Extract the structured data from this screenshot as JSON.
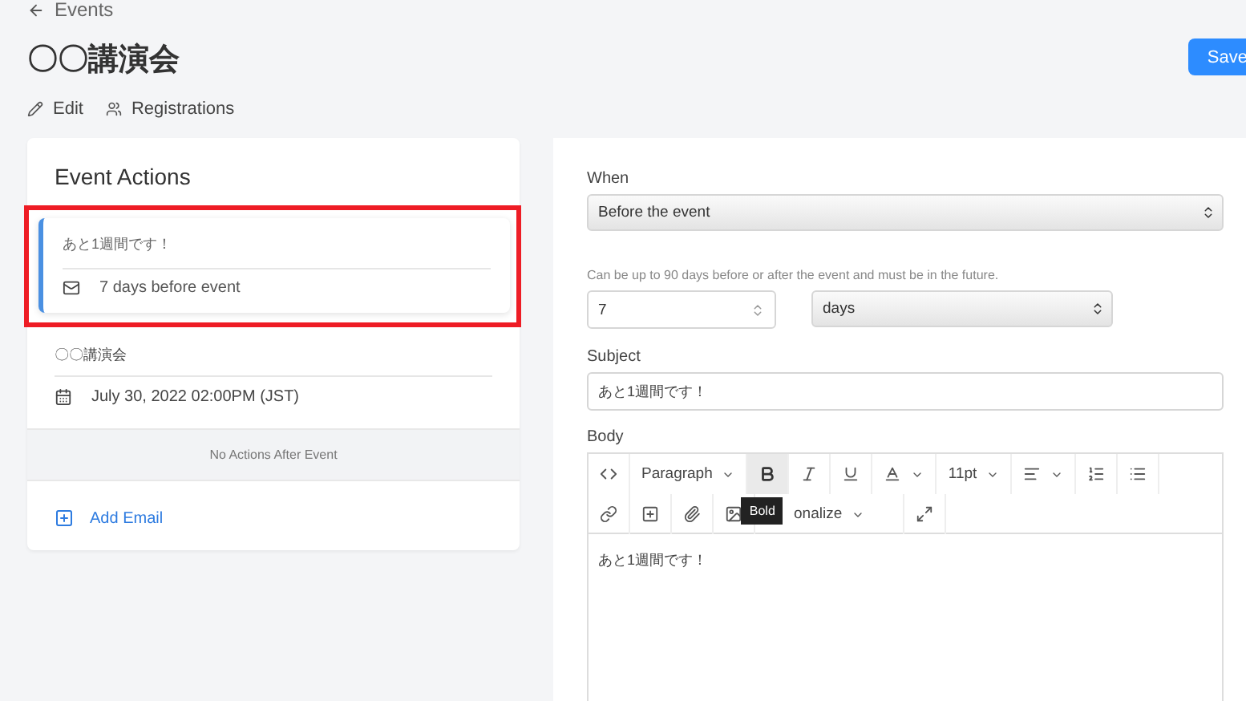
{
  "back_link": {
    "label": "Events"
  },
  "page_title": "〇〇講演会",
  "save_button": {
    "label": "Save"
  },
  "page_actions": [
    {
      "kind": "edit",
      "label": "Edit"
    },
    {
      "kind": "users",
      "label": "Registrations"
    }
  ],
  "event_actions": {
    "title": "Event Actions",
    "actions": [
      {
        "subject": "あと1週間です！",
        "timing": "7 days before event",
        "selected": true,
        "highlighted": true
      }
    ],
    "event": {
      "name": "〇〇講演会",
      "date": "July 30, 2022 02:00PM (JST)"
    },
    "after_event_note": "No Actions After Event",
    "add_button": {
      "label": "Add Email"
    }
  },
  "form": {
    "when": {
      "label": "When",
      "value": "Before the event"
    },
    "hint": "Can be up to 90 days before or after the event and must be in the future.",
    "offset": {
      "value": "7"
    },
    "unit": {
      "value": "days"
    },
    "subject": {
      "label": "Subject",
      "value": "あと1週間です！"
    },
    "body": {
      "label": "Body",
      "toolbar": [
        [
          {
            "kind": "code",
            "hover": false
          },
          {
            "kind": "dropdown",
            "label": "Paragraph",
            "hover": false
          },
          {
            "kind": "bold",
            "hover": true,
            "tooltip": "Bold"
          },
          {
            "kind": "italic",
            "hover": false
          },
          {
            "kind": "underline",
            "hover": false
          },
          {
            "kind": "color",
            "hover": false
          },
          {
            "kind": "dropdown",
            "label": "11pt",
            "hover": false
          },
          {
            "kind": "align",
            "hover": false
          },
          {
            "kind": "ordered-list",
            "hover": false
          },
          {
            "kind": "bullet-list",
            "hover": false
          }
        ],
        [
          {
            "kind": "link",
            "hover": false
          },
          {
            "kind": "add",
            "hover": false
          },
          {
            "kind": "attach",
            "hover": false
          },
          {
            "kind": "image",
            "hover": false
          },
          {
            "kind": "dropdown",
            "label": "onalize",
            "hover": false,
            "covered": true
          },
          {
            "kind": "fullscreen",
            "hover": false
          }
        ]
      ],
      "content": "あと1週間です！"
    }
  }
}
